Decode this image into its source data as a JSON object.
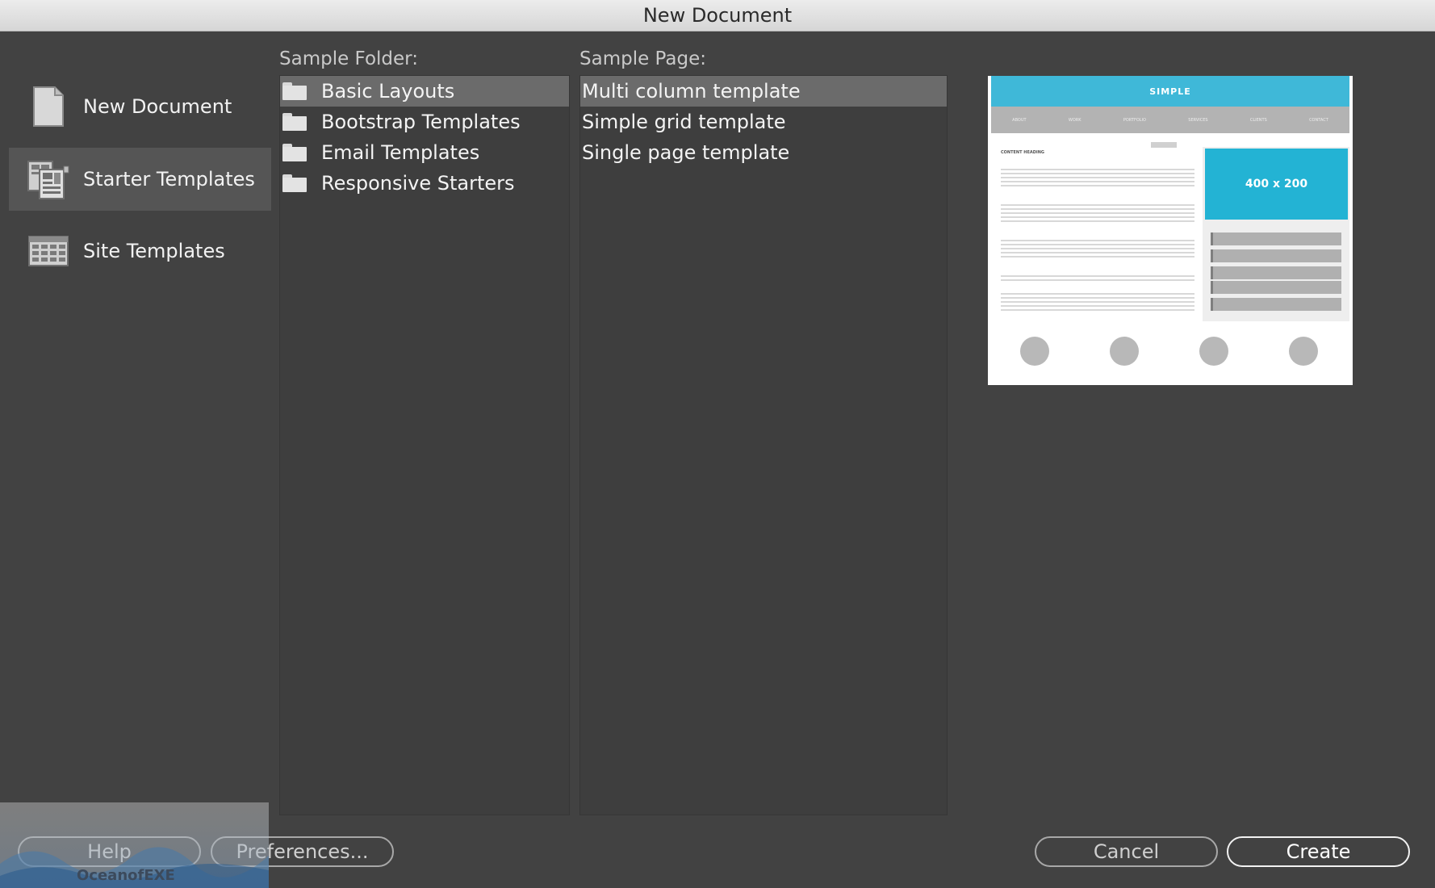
{
  "window": {
    "title": "New Document"
  },
  "sidebar": {
    "items": [
      {
        "label": "New Document",
        "icon": "blank-document-icon",
        "selected": false
      },
      {
        "label": "Starter Templates",
        "icon": "starter-templates-icon",
        "selected": true
      },
      {
        "label": "Site Templates",
        "icon": "site-templates-icon",
        "selected": false
      }
    ]
  },
  "folders": {
    "label": "Sample Folder:",
    "items": [
      {
        "label": "Basic Layouts",
        "selected": true
      },
      {
        "label": "Bootstrap Templates",
        "selected": false
      },
      {
        "label": "Email Templates",
        "selected": false
      },
      {
        "label": "Responsive Starters",
        "selected": false
      }
    ]
  },
  "pages": {
    "label": "Sample Page:",
    "items": [
      {
        "label": "Multi column template",
        "selected": true
      },
      {
        "label": "Simple grid template",
        "selected": false
      },
      {
        "label": "Single page template",
        "selected": false
      }
    ]
  },
  "preview": {
    "header": "SIMPLE",
    "nav": [
      "ABOUT",
      "WORK",
      "PORTFOLIO",
      "SERVICES",
      "CLIENTS",
      "CONTACT"
    ],
    "heading": "CONTENT HEADING",
    "image_placeholder": "400 x 200",
    "accent_color": "#3fb8d8"
  },
  "footer": {
    "help_label": "Help",
    "preferences_label": "Preferences...",
    "cancel_label": "Cancel",
    "create_label": "Create"
  },
  "watermark": {
    "text": "OceanofEXE"
  }
}
